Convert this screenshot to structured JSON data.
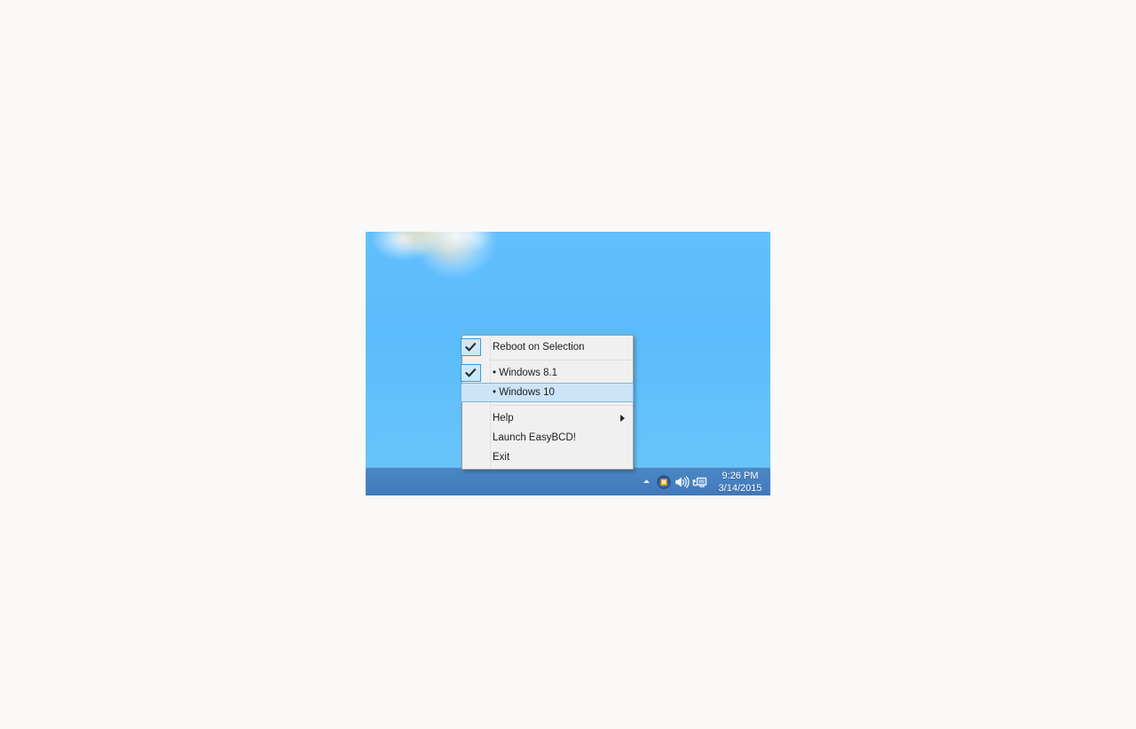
{
  "desktop": {
    "wallpaper_name": "blue-sky-wallpaper",
    "sky_color": "#5cbcfb",
    "taskbar_color": "#4680c0"
  },
  "taskbar": {
    "show_hidden_icons_label": "Show hidden icons",
    "tray_icons": [
      {
        "name": "show-hidden-icons-arrow",
        "label": "Show hidden icons"
      },
      {
        "name": "easybcd-tray-icon",
        "label": "EasyBCD"
      },
      {
        "name": "volume-icon",
        "label": "Speakers"
      },
      {
        "name": "network-icon",
        "label": "Network"
      }
    ],
    "clock": {
      "time": "9:26 PM",
      "date": "3/14/2015"
    }
  },
  "context_menu": {
    "groups": [
      {
        "items": [
          {
            "id": "reboot-on-selection",
            "label": "Reboot on Selection",
            "checked": true,
            "highlighted": false,
            "submenu": false
          }
        ]
      },
      {
        "items": [
          {
            "id": "windows-81",
            "label": "• Windows 8.1",
            "checked": true,
            "highlighted": false,
            "submenu": false
          },
          {
            "id": "windows-10",
            "label": "• Windows 10",
            "checked": false,
            "highlighted": true,
            "submenu": false
          }
        ]
      },
      {
        "items": [
          {
            "id": "help",
            "label": "Help",
            "checked": false,
            "highlighted": false,
            "submenu": true
          },
          {
            "id": "launch-easybcd",
            "label": "Launch EasyBCD!",
            "checked": false,
            "highlighted": false,
            "submenu": false
          },
          {
            "id": "exit",
            "label": "Exit",
            "checked": false,
            "highlighted": false,
            "submenu": false
          }
        ]
      }
    ],
    "colors": {
      "background": "#f0f0f0",
      "border": "#9a9a9a",
      "highlight_fill": "#cce4f7",
      "highlight_border": "#7eb4e2",
      "checkbox_fill": "#cfe7f8",
      "checkbox_border": "#3b9ad9"
    }
  }
}
